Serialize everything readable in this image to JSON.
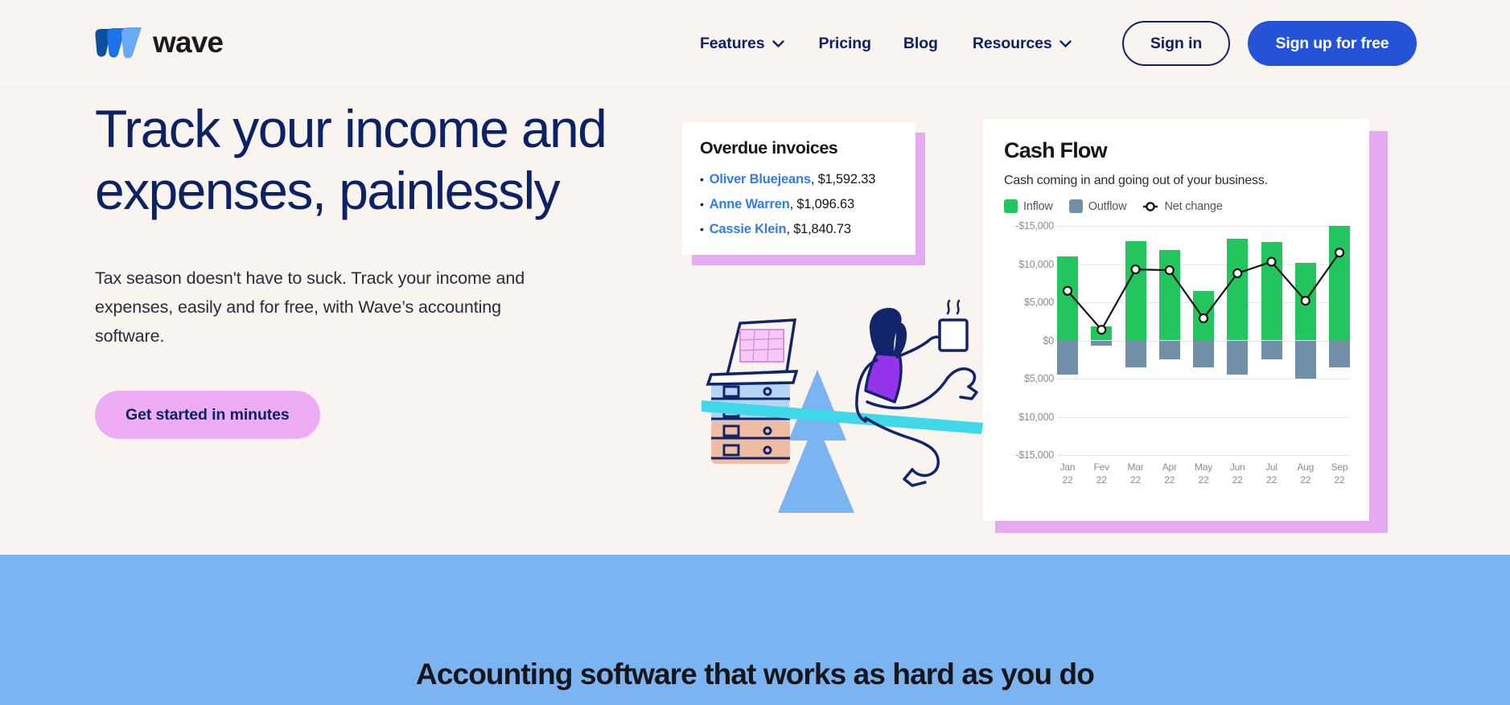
{
  "brand": {
    "name": "wave",
    "logo_colors": [
      "#0b4f9e",
      "#1a73e8",
      "#6aa9f5"
    ]
  },
  "header": {
    "nav": [
      {
        "label": "Features",
        "has_dropdown": true
      },
      {
        "label": "Pricing",
        "has_dropdown": false
      },
      {
        "label": "Blog",
        "has_dropdown": false
      },
      {
        "label": "Resources",
        "has_dropdown": true
      }
    ],
    "sign_in_label": "Sign in",
    "sign_up_label": "Sign up for free"
  },
  "hero": {
    "title": "Track your income and expenses, painlessly",
    "subtitle": "Tax season doesn't have to suck. Track your income and expenses, easily and for free, with Wave’s accounting software.",
    "cta_label": "Get started in minutes"
  },
  "overdue_card": {
    "title": "Overdue invoices",
    "bullet": "•",
    "items": [
      {
        "name": "Oliver Bluejeans",
        "amount": ", $1,592.33"
      },
      {
        "name": "Anne Warren",
        "amount": ", $1,096.63"
      },
      {
        "name": "Cassie Klein",
        "amount": ", $1,840.73"
      }
    ]
  },
  "colors": {
    "page_bg": "#faf4f0",
    "navy": "#0b2265",
    "blue_button": "#2553d8",
    "cta_purple": "#eeacf5",
    "card_shadow_purple": "#e6aaf2",
    "band_blue": "#7cb4f2",
    "inflow_green": "#22c55e",
    "outflow_slate": "#7190a8",
    "link_blue": "#2f7cf0"
  },
  "chart_data": {
    "type": "bar",
    "title": "Cash Flow",
    "subtitle": "Cash coming in and going out of your business.",
    "categories": [
      "Jan 22",
      "Fev 22",
      "Mar 22",
      "Apr 22",
      "May 22",
      "Jun 22",
      "Jul 22",
      "Aug 22",
      "Sep 22"
    ],
    "x_tick_lines": [
      [
        "Jan",
        "22"
      ],
      [
        "Fev",
        "22"
      ],
      [
        "Mar",
        "22"
      ],
      [
        "Apr",
        "22"
      ],
      [
        "May",
        "22"
      ],
      [
        "Jun",
        "22"
      ],
      [
        "Jul",
        "22"
      ],
      [
        "Aug",
        "22"
      ],
      [
        "Sep",
        "22"
      ]
    ],
    "series": [
      {
        "name": "Inflow",
        "type": "bar",
        "color": "#22c55e",
        "values": [
          11000,
          1800,
          13000,
          11800,
          6500,
          13300,
          12900,
          10200,
          15000
        ]
      },
      {
        "name": "Outflow",
        "type": "bar",
        "color": "#7190a8",
        "values": [
          -4500,
          -700,
          -3500,
          -2500,
          -3500,
          -4500,
          -2500,
          -5000,
          -3500
        ]
      },
      {
        "name": "Net change",
        "type": "line",
        "color": "#16161a",
        "values": [
          6500,
          1400,
          9300,
          9200,
          2900,
          8800,
          10300,
          5200,
          11500
        ]
      }
    ],
    "ylabel": "",
    "xlabel": "",
    "ylim": [
      -15000,
      15000
    ],
    "y_ticks": [
      15000,
      10000,
      5000,
      0,
      -5000,
      -10000,
      -15000
    ],
    "y_tick_labels": [
      "-$15,000",
      "$10,000",
      "$5,000",
      "$0",
      "$5,000",
      "$10,000",
      "-$15,000"
    ],
    "grid": true,
    "legend_position": "top-left",
    "legend": [
      "Inflow",
      "Outflow",
      "Net change"
    ]
  },
  "band": {
    "title": "Accounting software that works as hard as you do"
  }
}
